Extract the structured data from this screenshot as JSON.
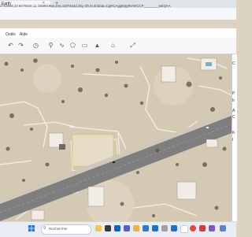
{
  "tab": {
    "title": "Earth",
    "close": "×",
    "new_tab": "+"
  },
  "address": {
    "text": "4763998,10.6275515,11,15588196a,104.4187464d,35y,-0h,0t,0r/data=CgRCAggBQgRIAhICCP________wEQAA"
  },
  "menu": {
    "items": [
      "Outils",
      "Aide"
    ]
  },
  "toolbar": {
    "icons": [
      "undo-icon",
      "redo-icon",
      "history-icon",
      "placemark-icon",
      "path-icon",
      "polygon-icon",
      "ruler-icon",
      "mountain-icon",
      "house-icon",
      "expand-icon"
    ]
  },
  "right_panel": {
    "letters": [
      "C",
      "P",
      "Ir",
      "A",
      "C",
      "K",
      "I"
    ]
  },
  "taskbar": {
    "search_placeholder": "Rechercher"
  },
  "colors": {
    "road": "#7b7b7b",
    "sand": "#d9cfbd",
    "wall": "#f0ece4",
    "taskbar": "#e9edf3"
  }
}
